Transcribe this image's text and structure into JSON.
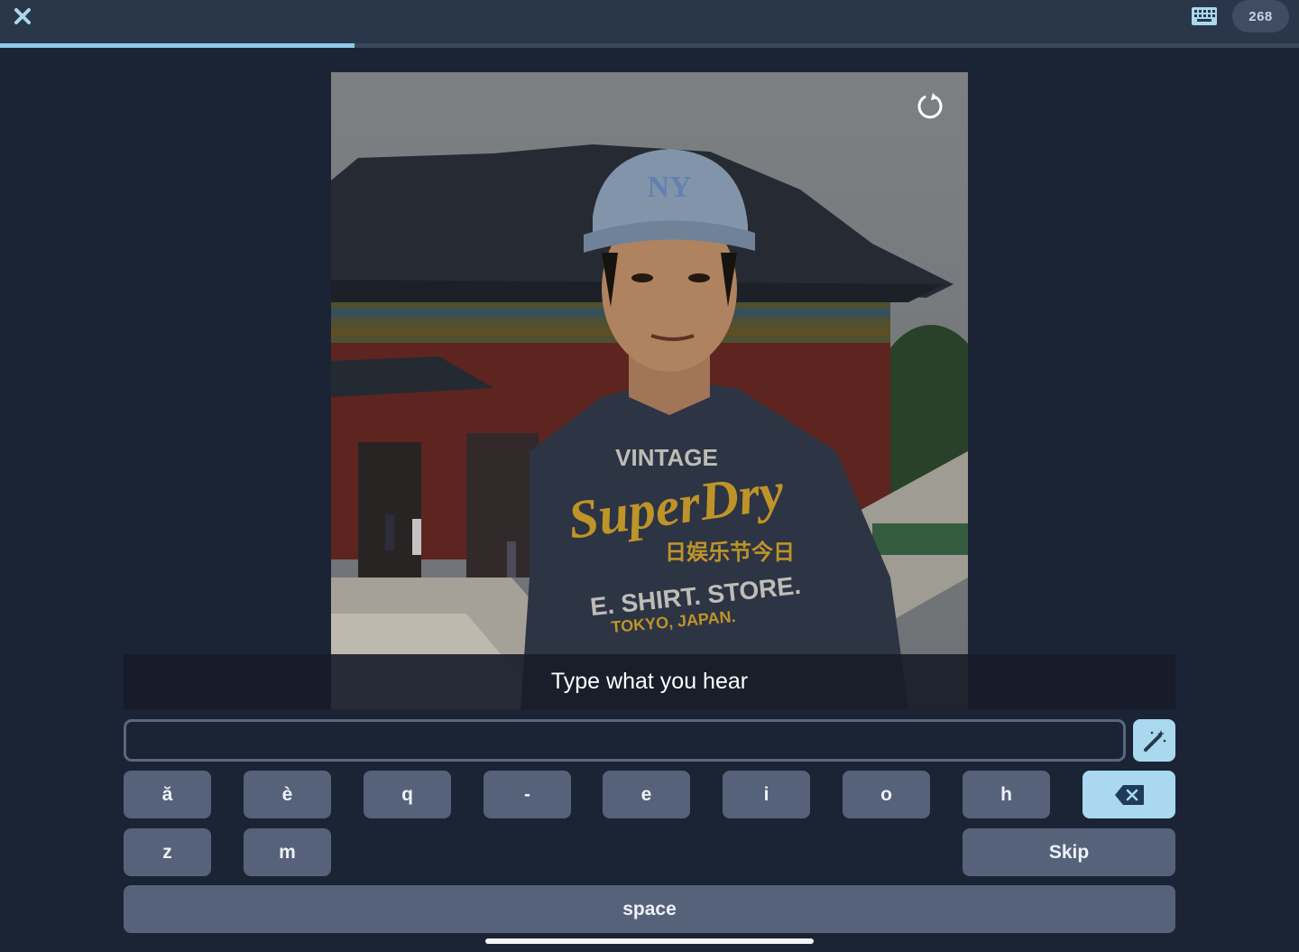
{
  "header": {
    "close_icon": "close-icon",
    "keyboard_icon": "keyboard-icon",
    "score": "268"
  },
  "progress": {
    "fraction": 0.273
  },
  "media": {
    "replay_icon": "replay-icon",
    "shirt_lines": [
      "VINTAGE",
      "SuperDry",
      "日娱乐节今日",
      "E. SHIRT. STORE.",
      "TOKYO, JAPAN."
    ],
    "caption": "Type what you hear"
  },
  "answer": {
    "value": "",
    "placeholder": "",
    "hint_icon": "magic-wand-icon"
  },
  "keyboard": {
    "row1": [
      "ă",
      "è",
      "q",
      "-",
      "e",
      "i",
      "o",
      "h"
    ],
    "backspace_icon": "backspace-icon",
    "row2": [
      "z",
      "m"
    ],
    "skip_label": "Skip",
    "space_label": "space"
  },
  "colors": {
    "background": "#1b2434",
    "topbar": "#2a3649",
    "progress_accent": "#8fc9e8",
    "key": "#56627a",
    "key_highlight": "#a9d8ef"
  }
}
